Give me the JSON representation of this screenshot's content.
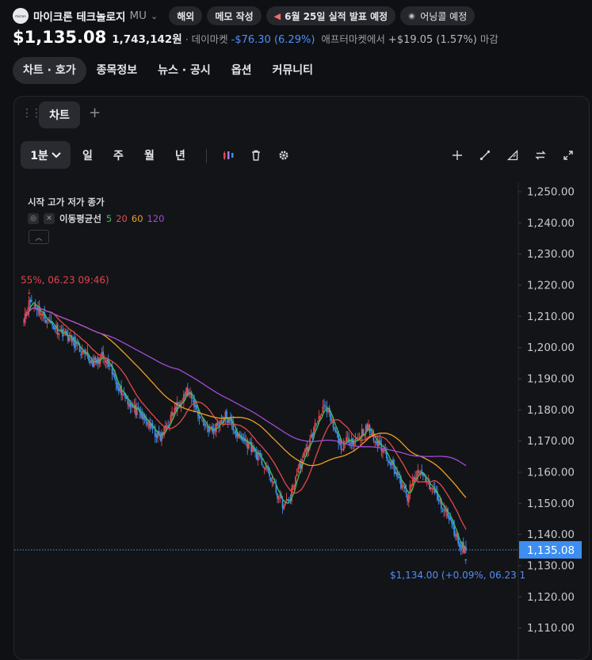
{
  "header": {
    "logo_text": "micron",
    "company_name": "마이크론 테크놀로지",
    "ticker": "MU",
    "badges": {
      "overseas": "해외",
      "memo": "메모 작성",
      "earnings": "6월 25일 실적 발표 예정",
      "earnings_call": "어닝콜 예정"
    },
    "price": "$1,135.08",
    "volume": "1,743,142원",
    "source_label": "· 데이마켓",
    "change": "-$76.30 (6.29%)",
    "after_label": "애프터마켓에서",
    "after_change": "+$19.05 (1.57%)",
    "after_status": "마감"
  },
  "tabs": [
    "차트 · 호가",
    "종목정보",
    "뉴스 · 공시",
    "옵션",
    "커뮤니티"
  ],
  "panel": {
    "tab_label": "차트",
    "add_label": "+",
    "timeframes": {
      "selected": "1분",
      "items": [
        "일",
        "주",
        "월",
        "년"
      ]
    },
    "tools": [
      "candle-icon",
      "trash-icon",
      "gear-icon",
      "crosshair-icon",
      "line-draw-icon",
      "ruler-icon",
      "swap-icon",
      "expand-icon"
    ]
  },
  "legend": {
    "ohlc_label": "시작 고가 저가 종가",
    "ma_label": "이동평균선",
    "periods": [
      "5",
      "20",
      "60",
      "120"
    ],
    "period_colors": [
      "#3cc05a",
      "#e24a4a",
      "#f0a020",
      "#a24bd6"
    ]
  },
  "colors": {
    "up": "#e24a4a",
    "down": "#3d8ef0",
    "price_tag": "#3d8ef0",
    "background": "#131417"
  },
  "chart_data": {
    "type": "candlestick",
    "y_ticks": [
      "1,250.00",
      "1,240.00",
      "1,230.00",
      "1,220.00",
      "1,210.00",
      "1,200.00",
      "1,190.00",
      "1,180.00",
      "1,170.00",
      "1,160.00",
      "1,150.00",
      "1,140.00",
      "1,130.00",
      "1,120.00",
      "1,110.00"
    ],
    "ylim": [
      1107,
      1252
    ],
    "current_price_label": "1,135.08",
    "current_price": 1135.08,
    "high_annotation": "55%, 06.23 09:46)",
    "low_annotation": "$1,134.00 (+0.09%, 06.23 1",
    "high_point": 1216,
    "low_point": 1134,
    "close_path": [
      1210,
      1215,
      1213,
      1210,
      1208,
      1206,
      1205,
      1203,
      1201,
      1198,
      1196,
      1195,
      1197,
      1194,
      1190,
      1186,
      1183,
      1180,
      1178,
      1176,
      1173,
      1171,
      1175,
      1179,
      1183,
      1186,
      1183,
      1178,
      1175,
      1173,
      1176,
      1178,
      1175,
      1171,
      1170,
      1168,
      1165,
      1162,
      1158,
      1153,
      1149,
      1152,
      1160,
      1165,
      1170,
      1176,
      1181,
      1178,
      1172,
      1168,
      1171,
      1170,
      1173,
      1174,
      1170,
      1168,
      1165,
      1161,
      1156,
      1152,
      1158,
      1160,
      1157,
      1154,
      1150,
      1147,
      1142,
      1137,
      1135
    ]
  }
}
